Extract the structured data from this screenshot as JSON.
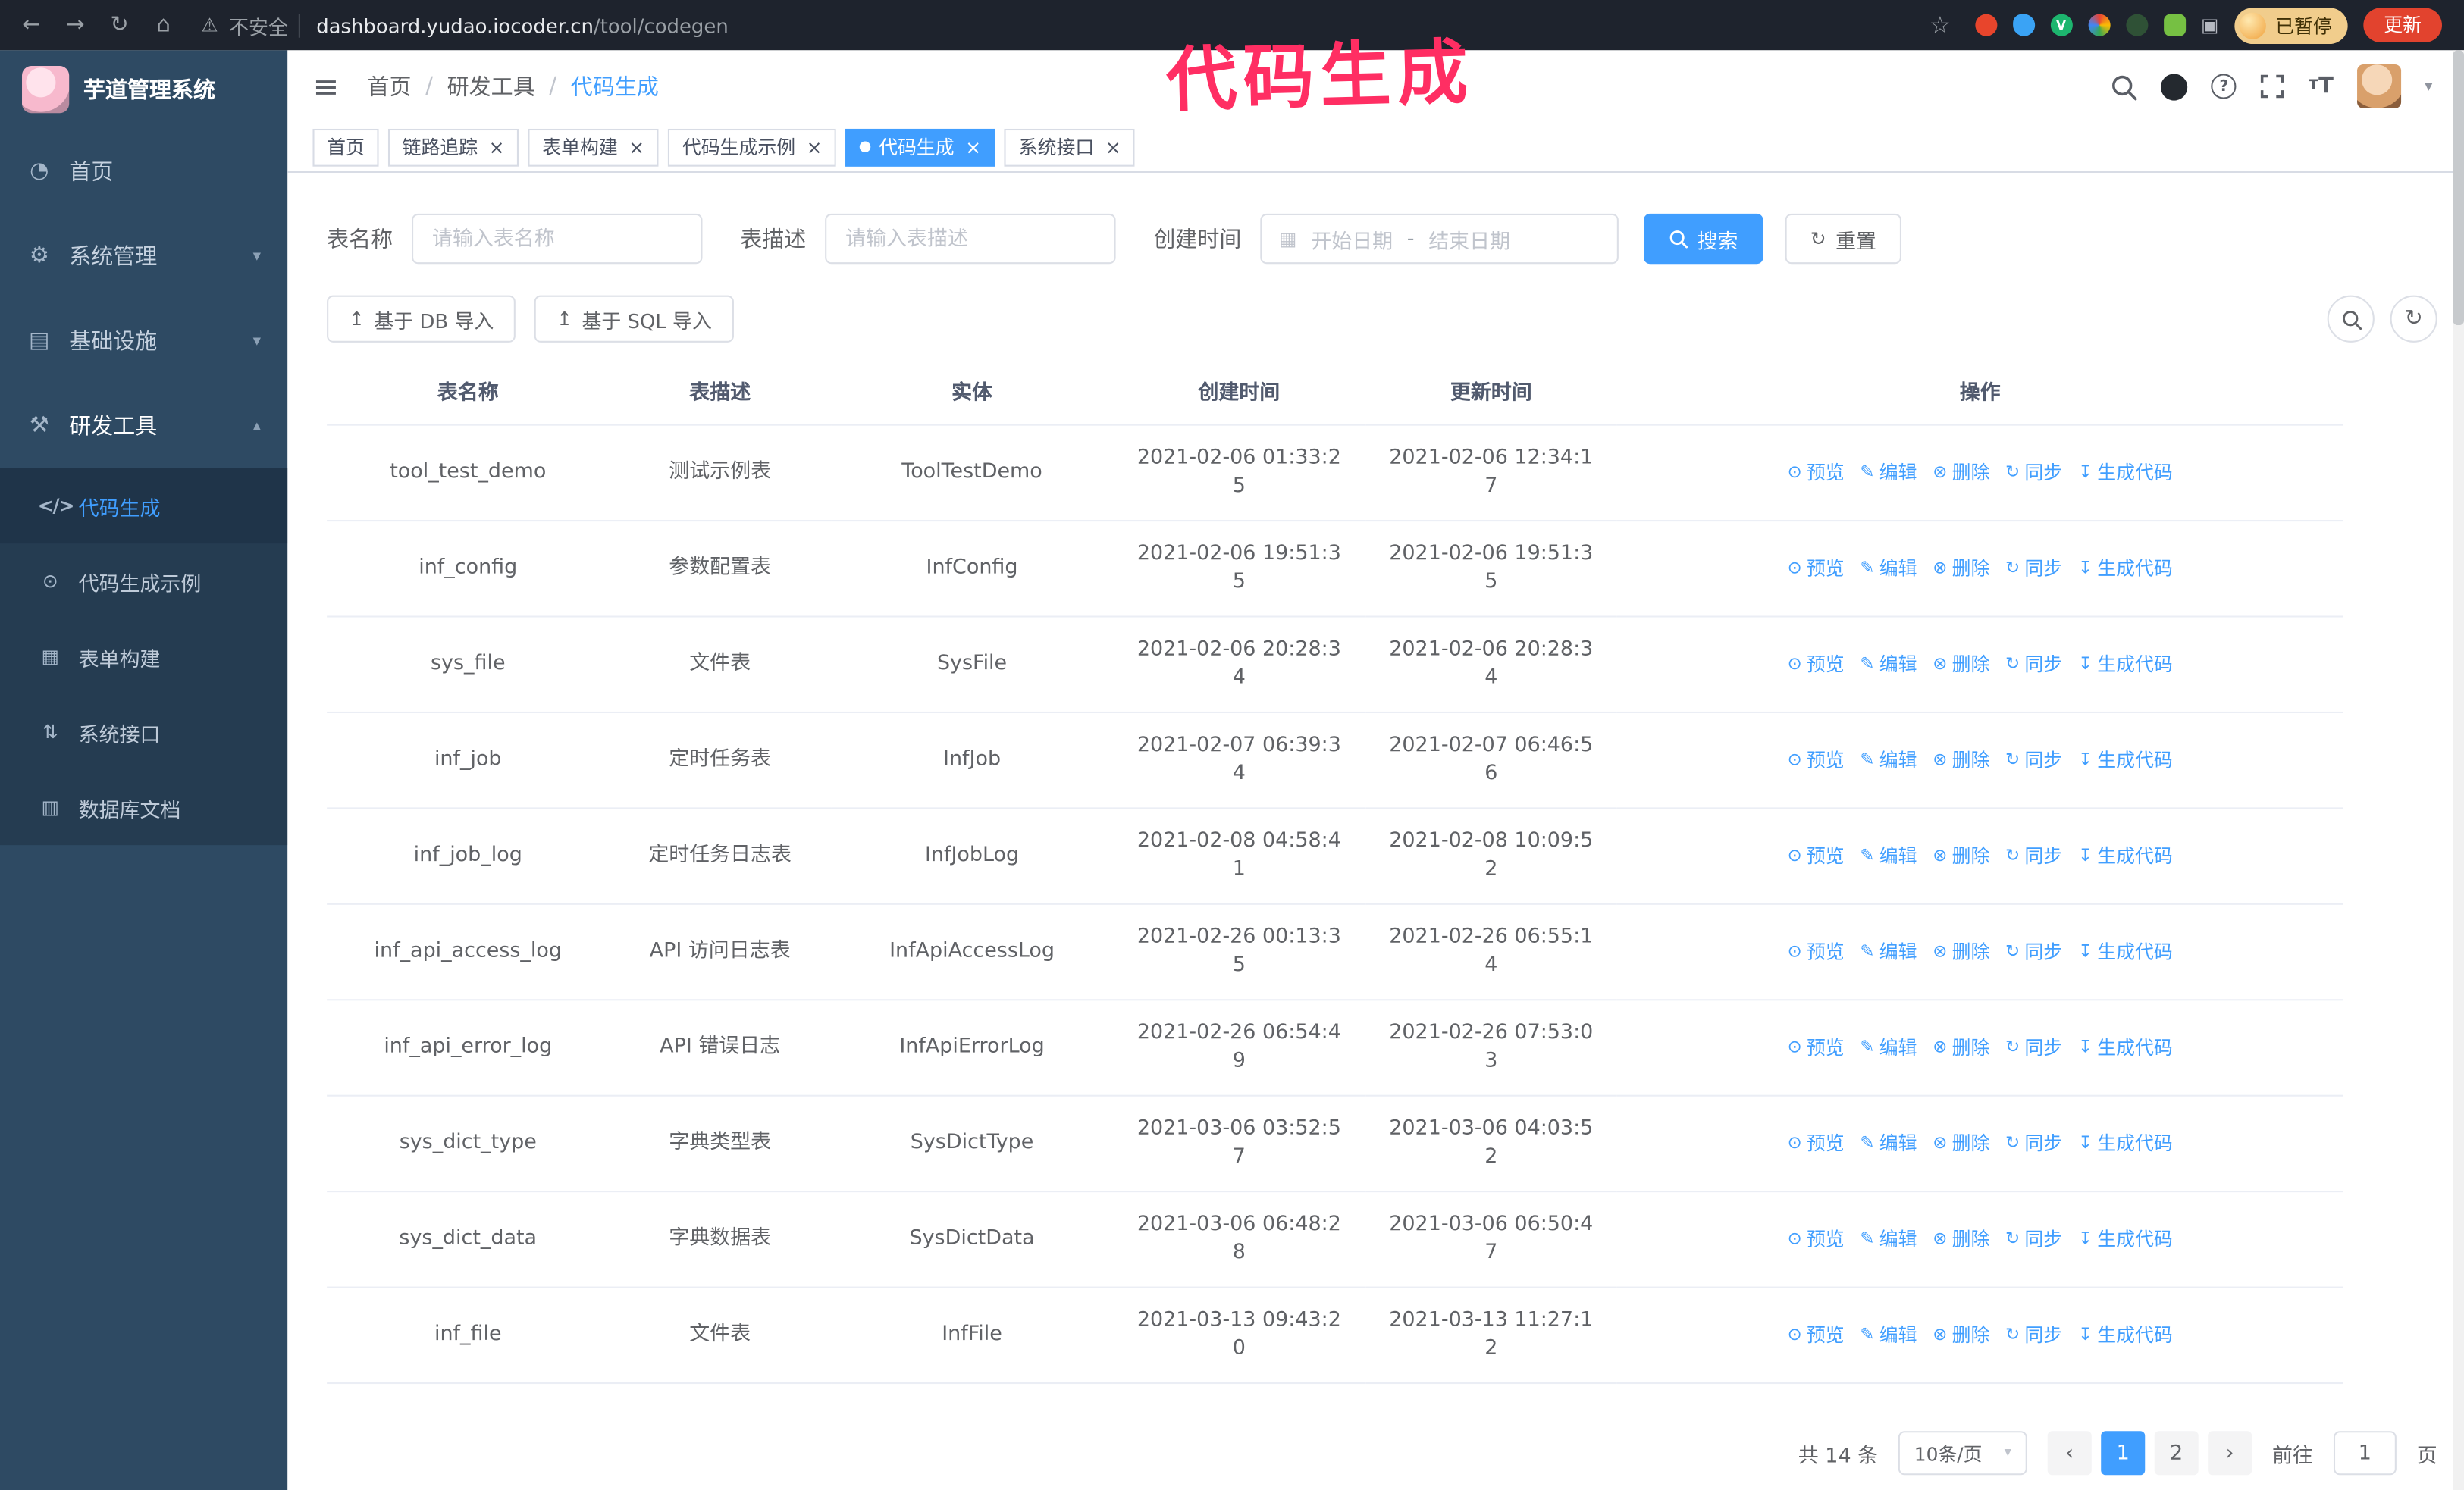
{
  "browser": {
    "security_warning": "不安全",
    "url_host": "dashboard.yudao.iocoder.cn",
    "url_path": "/tool/codegen",
    "profile_chip_label": "已暂停",
    "update_button_label": "更新"
  },
  "annotation": {
    "text": "代码生成",
    "color": "#ff2e63"
  },
  "colors": {
    "accent": "#409eff",
    "sidebar_bg": "#2e4a63",
    "submenu_bg": "#253c51",
    "annotation": "#ff2e63",
    "update_button": "#e2432e"
  },
  "sidebar": {
    "logo_title": "芋道管理系统",
    "items": [
      {
        "label": "首页"
      },
      {
        "label": "系统管理"
      },
      {
        "label": "基础设施"
      },
      {
        "label": "研发工具"
      }
    ],
    "subitems": [
      {
        "label": "代码生成",
        "active": true
      },
      {
        "label": "代码生成示例"
      },
      {
        "label": "表单构建"
      },
      {
        "label": "系统接口"
      },
      {
        "label": "数据库文档"
      }
    ]
  },
  "header": {
    "breadcrumb": [
      "首页",
      "研发工具",
      "代码生成"
    ],
    "separator": "/"
  },
  "tabs": [
    {
      "label": "首页"
    },
    {
      "label": "链路追踪"
    },
    {
      "label": "表单构建"
    },
    {
      "label": "代码生成示例"
    },
    {
      "label": "代码生成",
      "active": true
    },
    {
      "label": "系统接口"
    }
  ],
  "filters": {
    "table_name_label": "表名称",
    "table_name_placeholder": "请输入表名称",
    "table_desc_label": "表描述",
    "table_desc_placeholder": "请输入表描述",
    "create_time_label": "创建时间",
    "date_start_placeholder": "开始日期",
    "date_separator": "-",
    "date_end_placeholder": "结束日期",
    "search_button": "搜索",
    "reset_button": "重置"
  },
  "toolbar": {
    "import_db_button": "基于 DB 导入",
    "import_sql_button": "基于 SQL 导入"
  },
  "table": {
    "columns": [
      "表名称",
      "表描述",
      "实体",
      "创建时间",
      "更新时间",
      "操作"
    ],
    "actions": [
      "预览",
      "编辑",
      "删除",
      "同步",
      "生成代码"
    ],
    "rows": [
      {
        "name": "tool_test_demo",
        "desc": "测试示例表",
        "entity": "ToolTestDemo",
        "created": "2021-02-06 01:33:25",
        "updated": "2021-02-06 12:34:17"
      },
      {
        "name": "inf_config",
        "desc": "参数配置表",
        "entity": "InfConfig",
        "created": "2021-02-06 19:51:35",
        "updated": "2021-02-06 19:51:35"
      },
      {
        "name": "sys_file",
        "desc": "文件表",
        "entity": "SysFile",
        "created": "2021-02-06 20:28:34",
        "updated": "2021-02-06 20:28:34"
      },
      {
        "name": "inf_job",
        "desc": "定时任务表",
        "entity": "InfJob",
        "created": "2021-02-07 06:39:34",
        "updated": "2021-02-07 06:46:56"
      },
      {
        "name": "inf_job_log",
        "desc": "定时任务日志表",
        "entity": "InfJobLog",
        "created": "2021-02-08 04:58:41",
        "updated": "2021-02-08 10:09:52"
      },
      {
        "name": "inf_api_access_log",
        "desc": "API 访问日志表",
        "entity": "InfApiAccessLog",
        "created": "2021-02-26 00:13:35",
        "updated": "2021-02-26 06:55:14"
      },
      {
        "name": "inf_api_error_log",
        "desc": "API 错误日志",
        "entity": "InfApiErrorLog",
        "created": "2021-02-26 06:54:49",
        "updated": "2021-02-26 07:53:03"
      },
      {
        "name": "sys_dict_type",
        "desc": "字典类型表",
        "entity": "SysDictType",
        "created": "2021-03-06 03:52:57",
        "updated": "2021-03-06 04:03:52"
      },
      {
        "name": "sys_dict_data",
        "desc": "字典数据表",
        "entity": "SysDictData",
        "created": "2021-03-06 06:48:28",
        "updated": "2021-03-06 06:50:47"
      },
      {
        "name": "inf_file",
        "desc": "文件表",
        "entity": "InfFile",
        "created": "2021-03-13 09:43:20",
        "updated": "2021-03-13 11:27:12"
      }
    ]
  },
  "pagination": {
    "total_label": "共 14 条",
    "page_size_label": "10条/页",
    "pages": [
      "1",
      "2"
    ],
    "active_page": "1",
    "goto_label": "前往",
    "goto_value": "1",
    "goto_suffix": "页"
  },
  "icons": {
    "back": "←",
    "forward": "→",
    "reload": "↻",
    "home": "⌂",
    "warning": "⚠",
    "bookmark_star": "☆",
    "puzzle": "▣",
    "v_badge": "V",
    "hamburger": "≡",
    "caret_down": "▾",
    "chevron_down": "▾",
    "chevron_up": "▴",
    "dashboard": "◔",
    "system": "⚙",
    "infra": "▤",
    "tools": "⚒",
    "code": "</>",
    "example": "⊙",
    "form": "▦",
    "api": "⇅",
    "dbdoc": "▥",
    "calendar": "▦",
    "upload": "↥",
    "refresh": "↻",
    "preview": "⊙",
    "edit": "✎",
    "delete": "⊗",
    "sync": "↻",
    "generate": "↧",
    "close": "×",
    "prev": "‹",
    "next": "›",
    "help": "?",
    "letter_t": "T"
  }
}
